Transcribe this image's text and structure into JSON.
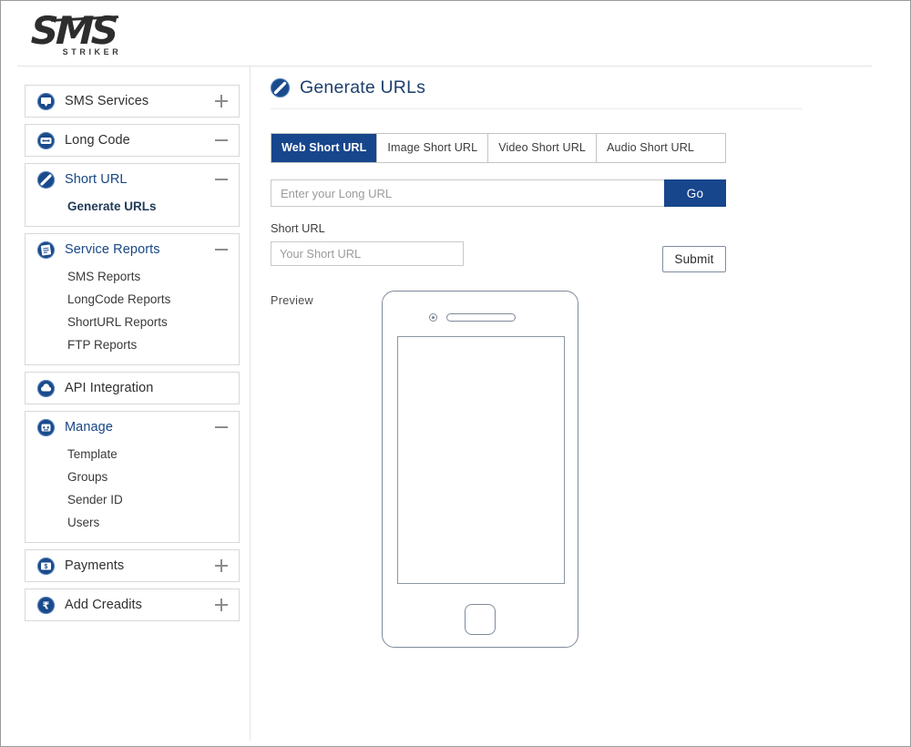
{
  "brand": {
    "logo_main": "SMS",
    "logo_sub": "STRIKER",
    "accent": "#17468c",
    "icon_blue": "#1a4a8c",
    "title_blue": "#1d3f6e"
  },
  "sidebar": {
    "groups": [
      {
        "label": "SMS Services",
        "icon": "chat-bubble-icon",
        "toggle": "plus",
        "open": false,
        "items": []
      },
      {
        "label": "Long Code",
        "icon": "long-code-icon",
        "toggle": "minus",
        "open": false,
        "items": []
      },
      {
        "label": "Short URL",
        "icon": "link-slash-icon",
        "toggle": "minus",
        "open": true,
        "items": [
          {
            "label": "Generate URLs",
            "active": true
          }
        ]
      },
      {
        "label": "Service Reports",
        "icon": "report-icon",
        "toggle": "minus",
        "open": true,
        "items": [
          {
            "label": "SMS Reports",
            "active": false
          },
          {
            "label": "LongCode Reports",
            "active": false
          },
          {
            "label": "ShortURL Reports",
            "active": false
          },
          {
            "label": "FTP Reports",
            "active": false
          }
        ]
      },
      {
        "label": "API Integration",
        "icon": "cloud-api-icon",
        "toggle": "none",
        "open": false,
        "items": []
      },
      {
        "label": "Manage",
        "icon": "manage-robot-icon",
        "toggle": "minus",
        "open": true,
        "items": [
          {
            "label": "Template",
            "active": false
          },
          {
            "label": "Groups",
            "active": false
          },
          {
            "label": "Sender ID",
            "active": false
          },
          {
            "label": "Users",
            "active": false
          }
        ]
      },
      {
        "label": "Payments",
        "icon": "payments-icon",
        "toggle": "plus",
        "open": false,
        "items": []
      },
      {
        "label": "Add Creadits",
        "icon": "rupee-icon",
        "toggle": "plus",
        "open": false,
        "items": []
      }
    ]
  },
  "main": {
    "page_title": "Generate URLs",
    "page_title_icon": "link-slash-icon",
    "tabs": [
      {
        "label": "Web Short URL",
        "active": true
      },
      {
        "label": "Image Short URL",
        "active": false
      },
      {
        "label": "Video Short URL",
        "active": false
      },
      {
        "label": "Audio Short URL",
        "active": false
      }
    ],
    "long_url": {
      "placeholder": "Enter your Long URL",
      "value": "",
      "button_label": "Go"
    },
    "short_url": {
      "label": "Short URL",
      "placeholder": "Your Short URL",
      "value": ""
    },
    "submit_label": "Submit",
    "preview": {
      "label": "Preview",
      "device": "mobile-phone-mockup"
    }
  }
}
